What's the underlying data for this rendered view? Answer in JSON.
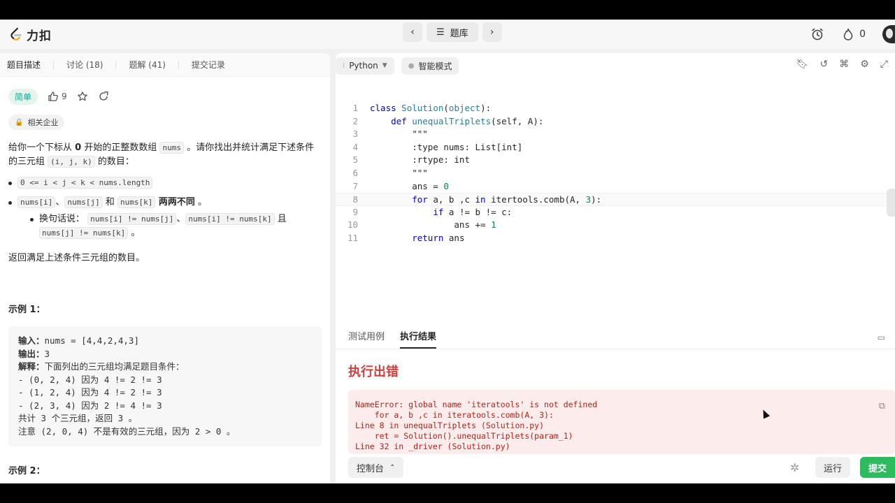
{
  "app": {
    "logo_text": "力扣"
  },
  "nav": {
    "title": "题库",
    "prev_icon": "chevron-left-icon",
    "next_icon": "chevron-right-icon",
    "list_icon": "list-icon"
  },
  "top_right": {
    "streak_count": "0",
    "alarm_icon": "alarm-clock-icon",
    "fire_icon": "fire-icon"
  },
  "left_tabs": [
    {
      "label": "题目描述"
    },
    {
      "label": "讨论 (18)"
    },
    {
      "label": "题解 (41)"
    },
    {
      "label": "提交记录"
    }
  ],
  "problem": {
    "difficulty": "简单",
    "likes": "9",
    "company_tag": "相关企业",
    "desc_line1_a": "给你一个下标从 ",
    "desc_line1_b": "0",
    "desc_line1_c": " 开始的正整数数组 ",
    "desc_code_nums": "nums",
    "desc_line1_d": " 。请你找出并统计满足下述条件的三元组 ",
    "desc_code_ijk": "(i, j, k)",
    "desc_line1_e": " 的数目：",
    "cond1_code": "0 <= i < j < k < nums.length",
    "cond2_code_a": "nums[i]",
    "cond2_sep1": "、",
    "cond2_code_b": "nums[j]",
    "cond2_and": " 和 ",
    "cond2_code_c": "nums[k]",
    "cond2_bold": " 两两不同",
    "cond2_end": " 。",
    "sub_label": "换句话说：",
    "sub_code_a": "nums[i] != nums[j]",
    "sub_sep": "、",
    "sub_code_b": "nums[i] != nums[k]",
    "sub_and": " 且",
    "sub_code_c": "nums[j] != nums[k]",
    "sub_end": " 。",
    "return_text": "返回满足上述条件三元组的数目。",
    "example1_title": "示例 1：",
    "example1": {
      "input_label": "输入：",
      "input_value": "nums = [4,4,2,4,3]",
      "output_label": "输出：",
      "output_value": "3",
      "explain_label": "解释：",
      "explain_value": "下面列出的三元组均满足题目条件：",
      "lines": [
        "- (0, 2, 4) 因为 4 != 2 != 3",
        "- (1, 2, 4) 因为 4 != 2 != 3",
        "- (2, 3, 4) 因为 2 != 4 != 3",
        "共计 3 个三元组，返回 3 。",
        "注意 (2, 0, 4) 不是有效的三元组，因为 2 > 0 。"
      ]
    },
    "example2_title": "示例 2："
  },
  "editor": {
    "language": "Python",
    "mode": "智能模式",
    "line_numbers": [
      "1",
      "2",
      "3",
      "4",
      "5",
      "6",
      "7",
      "8",
      "9",
      "10",
      "11"
    ]
  },
  "result": {
    "tabs": [
      {
        "label": "测试用例"
      },
      {
        "label": "执行结果"
      }
    ],
    "error_title": "执行出错",
    "error_text": "NameError: global name 'iteratools' is not defined\n    for a, b ,c in iteratools.comb(A, 3):\nLine 8 in unequalTriplets (Solution.py)\n    ret = Solution().unequalTriplets(param_1)\nLine 32 in _driver (Solution.py)",
    "console_label": "控制台",
    "run_label": "运行",
    "submit_label": "提交"
  }
}
